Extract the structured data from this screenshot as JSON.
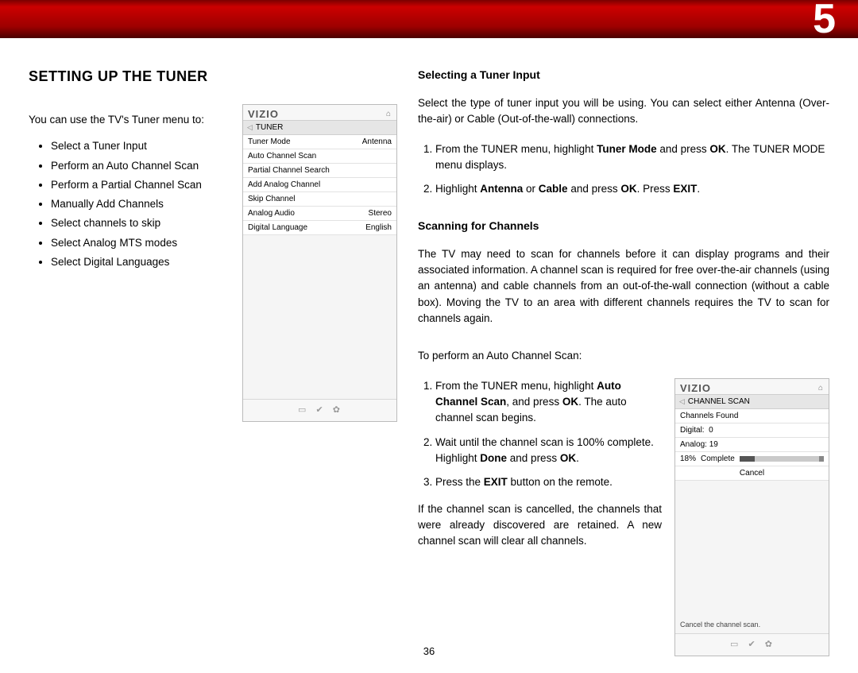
{
  "chapter_number": "5",
  "page_number": "36",
  "section_title": "Setting Up the Tuner",
  "intro_sentence": "You can use the TV's Tuner menu to:",
  "intro_bullets": [
    "Select a Tuner Input",
    "Perform an Auto Channel Scan",
    "Perform a Partial Channel Scan",
    "Manually Add Channels",
    "Select channels to skip",
    "Select Analog MTS modes",
    "Select Digital Languages"
  ],
  "tuner_widget": {
    "brand": "VIZIO",
    "crumb": "TUNER",
    "rows": [
      {
        "label": "Tuner Mode",
        "value": "Antenna"
      },
      {
        "label": "Auto Channel Scan",
        "value": ""
      },
      {
        "label": "Partial Channel Search",
        "value": ""
      },
      {
        "label": "Add Analog Channel",
        "value": ""
      },
      {
        "label": "Skip Channel",
        "value": ""
      },
      {
        "label": "Analog Audio",
        "value": "Stereo"
      },
      {
        "label": "Digital Language",
        "value": "English"
      }
    ]
  },
  "scan_widget": {
    "brand": "VIZIO",
    "crumb": "CHANNEL SCAN",
    "channels_found_label": "Channels Found",
    "digital_label": "Digital: ",
    "digital_count": "0",
    "analog_label": "Analog: ",
    "analog_count": "19",
    "percent_label": "18%",
    "complete_label": "Complete",
    "progress_percent": 18,
    "cancel_label": "Cancel",
    "hint": "Cancel the channel scan."
  },
  "right": {
    "sub1_title": "Selecting a Tuner Input",
    "sub1_para": "Select the type of tuner input you will be using. You can select either Antenna (Over-the-air) or Cable (Out-of-the-wall) connections.",
    "sub1_step1_pre": "From the TUNER menu, highlight ",
    "sub1_step1_b1": "Tuner Mode",
    "sub1_step1_mid": " and press ",
    "sub1_step1_b2": "OK",
    "sub1_step1_post": ". The TUNER MODE menu displays.",
    "sub1_step2_pre": "Highlight ",
    "sub1_step2_b1": "Antenna",
    "sub1_step2_mid1": " or ",
    "sub1_step2_b2": "Cable",
    "sub1_step2_mid2": " and press ",
    "sub1_step2_b3": "OK",
    "sub1_step2_mid3": ". Press ",
    "sub1_step2_b4": "EXIT",
    "sub1_step2_post": ".",
    "sub2_title": "Scanning for Channels",
    "sub2_para": "The TV may need to scan for channels before it can display programs and their associated information. A channel scan is required for free over-the-air channels (using an antenna) and cable channels from an out-of-the-wall connection (without a cable box). Moving the TV to an area with different channels requires the TV to scan for channels again.",
    "sub2_lead": "To perform an Auto Channel Scan:",
    "sub2_step1_pre": "From the TUNER menu, highlight ",
    "sub2_step1_b1": "Auto Channel Scan",
    "sub2_step1_mid": ", and press ",
    "sub2_step1_b2": "OK",
    "sub2_step1_post": ". The auto channel scan begins.",
    "sub2_step2_pre": "Wait until the channel scan is 100% complete. Highlight ",
    "sub2_step2_b1": "Done",
    "sub2_step2_mid": " and press ",
    "sub2_step2_b2": "OK",
    "sub2_step2_post": ".",
    "sub2_step3_pre": "Press the ",
    "sub2_step3_b1": "EXIT",
    "sub2_step3_post": " button on the remote.",
    "sub2_tail": "If the channel scan is cancelled, the channels that were already discovered are retained. A new channel scan will clear all channels."
  }
}
